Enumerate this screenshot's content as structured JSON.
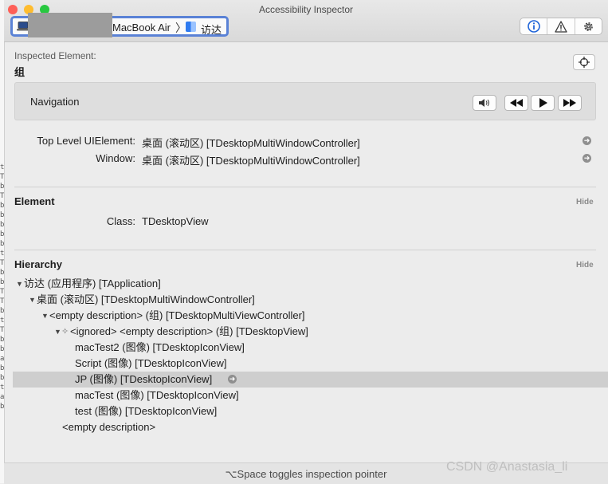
{
  "window": {
    "title": "Accessibility Inspector",
    "traffic_colors": [
      "#fe5f57",
      "#febc2e",
      "#28c840"
    ]
  },
  "toolbar": {
    "device": "MacBook Air",
    "chevron": "〉",
    "app": "访达",
    "segments": [
      "info-icon",
      "warning-icon",
      "gear-icon"
    ]
  },
  "inspected": {
    "label": "Inspected Element:",
    "value": "组"
  },
  "navigation": {
    "label": "Navigation",
    "buttons": [
      "speaker-icon",
      "rewind-icon",
      "play-icon",
      "fast-forward-icon"
    ]
  },
  "properties": {
    "top_level_key": "Top Level UIElement:",
    "top_level_value": "桌面 (滚动区) [TDesktopMultiWindowController]",
    "window_key": "Window:",
    "window_value": "桌面 (滚动区) [TDesktopMultiWindowController]"
  },
  "element": {
    "title": "Element",
    "hide": "Hide",
    "class_key": "Class:",
    "class_value": "TDesktopView"
  },
  "hierarchy": {
    "title": "Hierarchy",
    "hide": "Hide",
    "rows": [
      {
        "text": "访达 (应用程序) [TApplication]",
        "expanded": true
      },
      {
        "text": "桌面 (滚动区) [TDesktopMultiWindowController]",
        "expanded": true
      },
      {
        "text": "<empty description> (组) [TDesktopMultiViewController]",
        "expanded": true
      },
      {
        "text": "<ignored> <empty description> (组) [TDesktopView]",
        "expanded": true
      },
      {
        "text": "macTest2 (图像) [TDesktopIconView]",
        "expanded": false
      },
      {
        "text": "Script (图像) [TDesktopIconView]",
        "expanded": false
      },
      {
        "text": "JP (图像) [TDesktopIconView]",
        "expanded": false,
        "selected": true
      },
      {
        "text": "macTest (图像) [TDesktopIconView]",
        "expanded": false
      },
      {
        "text": "test (图像) [TDesktopIconView]",
        "expanded": false
      },
      {
        "text": "<empty description>",
        "expanded": false
      }
    ]
  },
  "background_chars": [
    "t",
    "T",
    "b",
    "T",
    "b",
    "b",
    "b",
    "b",
    "b",
    "t",
    "T",
    "b",
    "b",
    "T",
    "T",
    "b",
    "t",
    "T",
    "b",
    "b",
    "a",
    "b",
    "b",
    "t",
    "a",
    "b"
  ],
  "status": {
    "text": "⌥Space toggles inspection pointer"
  },
  "watermark": "CSDN @Anastasia_li"
}
